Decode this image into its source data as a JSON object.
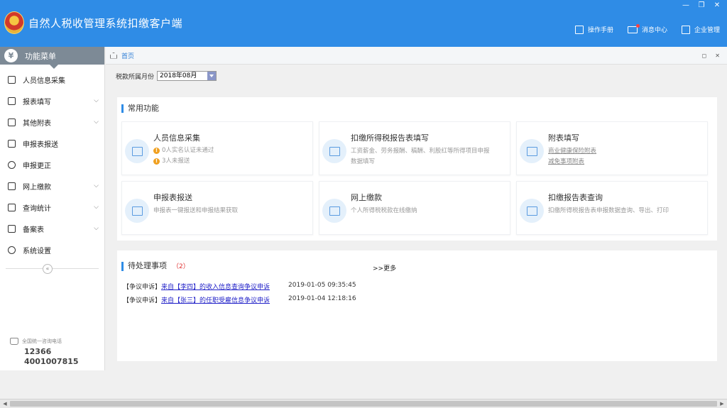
{
  "app": {
    "title": "自然人税收管理系统扣缴客户端"
  },
  "window_controls": [
    "—",
    "❐",
    "✕"
  ],
  "top_links": [
    {
      "label": "操作手册",
      "icon": "manual-icon"
    },
    {
      "label": "消息中心",
      "icon": "mail-icon"
    },
    {
      "label": "企业管理",
      "icon": "building-icon"
    }
  ],
  "sidebar": {
    "header": "功能菜单",
    "header_icon": "yen-icon",
    "items": [
      {
        "label": "人员信息采集",
        "icon": "person-icon",
        "expandable": false
      },
      {
        "label": "报表填写",
        "icon": "edit-icon",
        "expandable": true
      },
      {
        "label": "其他附表",
        "icon": "grid-icon",
        "expandable": true
      },
      {
        "label": "申报表报送",
        "icon": "report-send-icon",
        "expandable": false
      },
      {
        "label": "申报更正",
        "icon": "search-icon",
        "expandable": false
      },
      {
        "label": "网上缴款",
        "icon": "folder-icon",
        "expandable": true
      },
      {
        "label": "查询统计",
        "icon": "query-icon",
        "expandable": true
      },
      {
        "label": "备案表",
        "icon": "document-icon",
        "expandable": true
      },
      {
        "label": "系统设置",
        "icon": "gear-icon",
        "expandable": false
      }
    ],
    "collapse": "«",
    "hotline": {
      "label": "全国统一咨询电话",
      "numbers": [
        "12366",
        "4001007815"
      ]
    }
  },
  "breadcrumb": {
    "home": "首页",
    "right_icons": [
      "◻",
      "✕"
    ]
  },
  "period": {
    "label": "税款所属月份",
    "value": "2018年08月"
  },
  "common": {
    "title": "常用功能",
    "cards": [
      {
        "title": "人员信息采集",
        "lines": [
          "0人实名认证未通过",
          "3人未报送"
        ],
        "warn": true
      },
      {
        "title": "扣缴所得税报告表填写",
        "lines": [
          "工资薪金、劳务报酬、稿酬、利股红等所得项目申报",
          "数据填写"
        ],
        "warn": false
      },
      {
        "title": "附表填写",
        "lines": [
          "商业健康保险附表",
          "减免事项附表"
        ],
        "warn": false,
        "links": true
      },
      {
        "title": "申报表报送",
        "lines": [
          "申报表一键报送和申报结果获取"
        ],
        "warn": false
      },
      {
        "title": "网上缴款",
        "lines": [
          "个人所得税税款在线缴纳"
        ],
        "warn": false
      },
      {
        "title": "扣缴报告表查询",
        "lines": [
          "扣缴所得税报告表申报数据查询、导出、打印"
        ],
        "warn": false
      }
    ]
  },
  "todo": {
    "title": "待处理事项",
    "count": "（2）",
    "more": ">>更多",
    "rows": [
      {
        "tag": "【争议申诉】",
        "text": "来自【李四】的收入信息查询争议申诉",
        "date": "2019-01-05   09:35:45"
      },
      {
        "tag": "【争议申诉】",
        "text": "来自【张三】的任职受雇信息争议申诉",
        "date": "2019-01-04   12:18:16"
      }
    ]
  },
  "colors": {
    "brand": "#2f8ce6",
    "sidebar_header": "#7d8a96",
    "warn": "#f0a020",
    "count": "#e03030"
  }
}
